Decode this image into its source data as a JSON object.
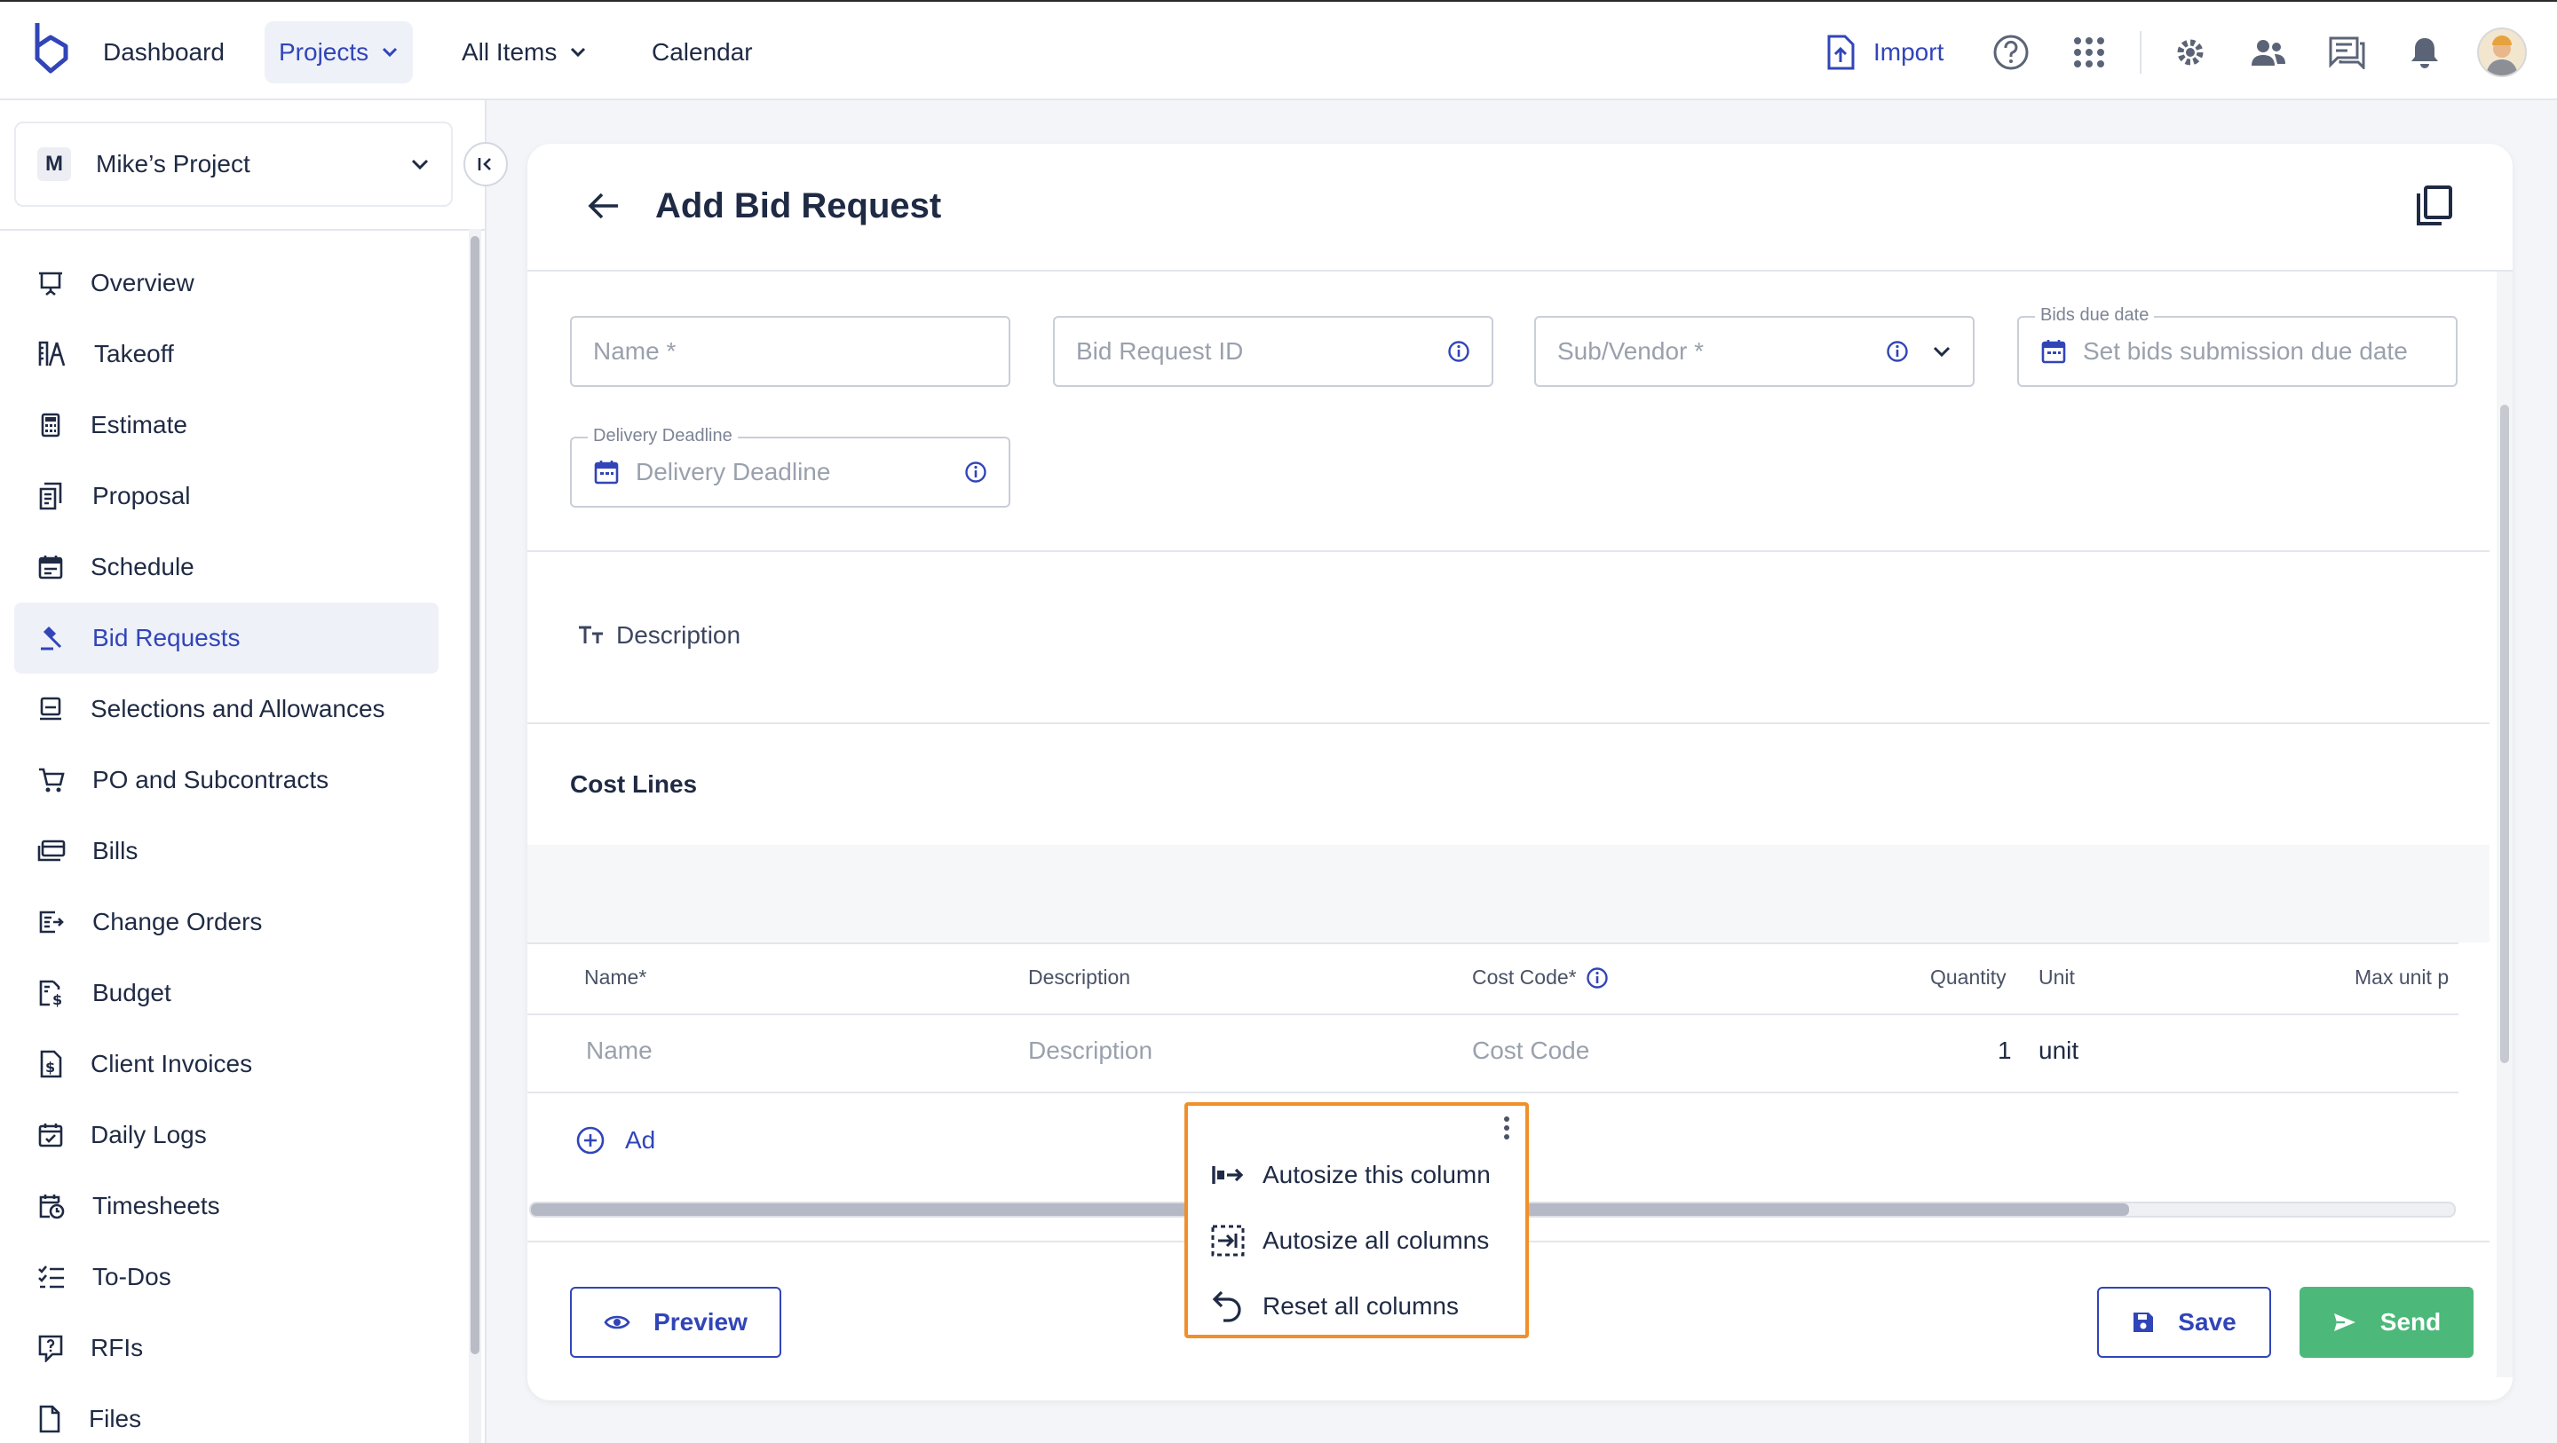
{
  "nav": {
    "dashboard": "Dashboard",
    "projects": "Projects",
    "all_items": "All Items",
    "calendar": "Calendar",
    "import": "Import"
  },
  "sidebar": {
    "project_badge": "M",
    "project_name": "Mike’s Project",
    "items": [
      {
        "label": "Overview",
        "icon": "presentation-icon"
      },
      {
        "label": "Takeoff",
        "icon": "takeoff-icon"
      },
      {
        "label": "Estimate",
        "icon": "calculator-icon"
      },
      {
        "label": "Proposal",
        "icon": "proposal-icon"
      },
      {
        "label": "Schedule",
        "icon": "calendar-icon"
      },
      {
        "label": "Bid Requests",
        "icon": "gavel-icon"
      },
      {
        "label": "Selections and Allowances",
        "icon": "selections-icon"
      },
      {
        "label": "PO and Subcontracts",
        "icon": "cart-icon"
      },
      {
        "label": "Bills",
        "icon": "bills-icon"
      },
      {
        "label": "Change Orders",
        "icon": "change-orders-icon"
      },
      {
        "label": "Budget",
        "icon": "budget-icon"
      },
      {
        "label": "Client Invoices",
        "icon": "invoice-icon"
      },
      {
        "label": "Daily Logs",
        "icon": "daily-log-icon"
      },
      {
        "label": "Timesheets",
        "icon": "timesheet-icon"
      },
      {
        "label": "To-Dos",
        "icon": "todo-icon"
      },
      {
        "label": "RFIs",
        "icon": "rfi-icon"
      },
      {
        "label": "Files",
        "icon": "file-icon"
      }
    ],
    "active_index": 5
  },
  "page": {
    "title": "Add Bid Request"
  },
  "form": {
    "name_placeholder": "Name *",
    "bid_id_placeholder": "Bid Request ID",
    "vendor_placeholder": "Sub/Vendor *",
    "bids_due_label": "Bids due date",
    "bids_due_placeholder": "Set bids submission due date",
    "delivery_label": "Delivery Deadline",
    "delivery_placeholder": "Delivery Deadline",
    "description_label": "Description"
  },
  "cost_lines": {
    "title": "Cost Lines",
    "headers": {
      "name": "Name*",
      "description": "Description",
      "cost_code": "Cost Code*",
      "quantity": "Quantity",
      "unit": "Unit",
      "max_unit": "Max unit p"
    },
    "row": {
      "name": "Name",
      "description": "Description",
      "cost_code": "Cost Code",
      "quantity": "1",
      "unit": "unit"
    },
    "add_line": "Ad"
  },
  "context_menu": {
    "items": [
      "Autosize this column",
      "Autosize all columns",
      "Reset all columns"
    ]
  },
  "buttons": {
    "preview": "Preview",
    "save": "Save",
    "send": "Send"
  },
  "colors": {
    "accent": "#3145b8",
    "send": "#4cb87a",
    "menu_highlight": "#f0902b"
  }
}
